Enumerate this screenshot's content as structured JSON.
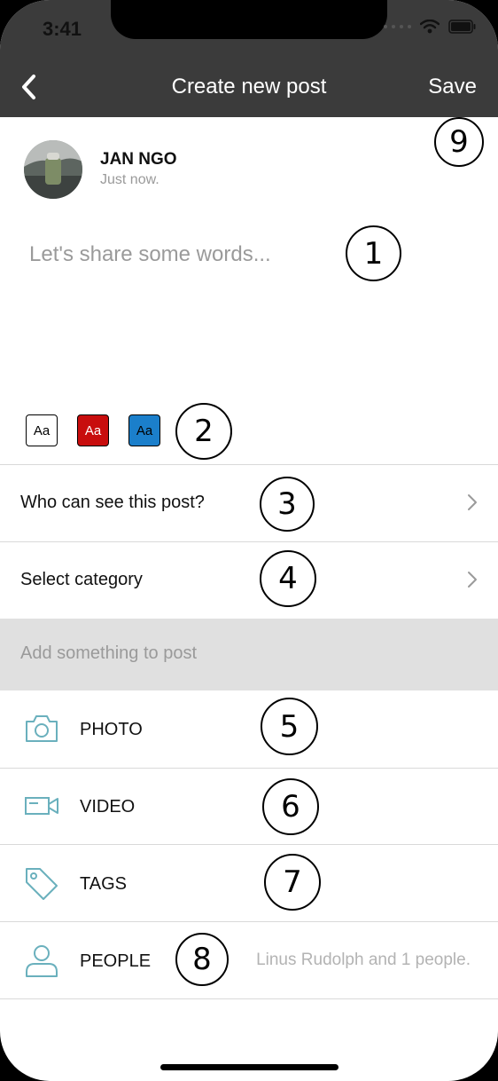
{
  "status_bar": {
    "time": "3:41"
  },
  "nav": {
    "title": "Create new post",
    "save_label": "Save"
  },
  "author": {
    "name": "JAN NGO",
    "time": "Just now."
  },
  "composer": {
    "placeholder": "Let's share some words..."
  },
  "text_formats": [
    {
      "label": "Aa",
      "bg": "#ffffff",
      "fg": "#000000"
    },
    {
      "label": "Aa",
      "bg": "#c80d0d",
      "fg": "#ffffff"
    },
    {
      "label": "Aa",
      "bg": "#1b7fcb",
      "fg": "#000000"
    }
  ],
  "settings": {
    "privacy_label": "Who can see this post?",
    "category_label": "Select category"
  },
  "attachments": {
    "header": "Add something to post",
    "items": [
      "PHOTO",
      "VIDEO",
      "TAGS",
      "PEOPLE"
    ],
    "people_value": "Linus Rudolph and 1 people."
  },
  "markers": [
    "9",
    "1",
    "2",
    "3",
    "4",
    "5",
    "6",
    "7",
    "8"
  ],
  "colors": {
    "nav_bg": "#3b3b3b",
    "icon_teal": "#6ab0bd",
    "divider": "#d9d9d9",
    "section_bg": "#e0e0e0"
  }
}
